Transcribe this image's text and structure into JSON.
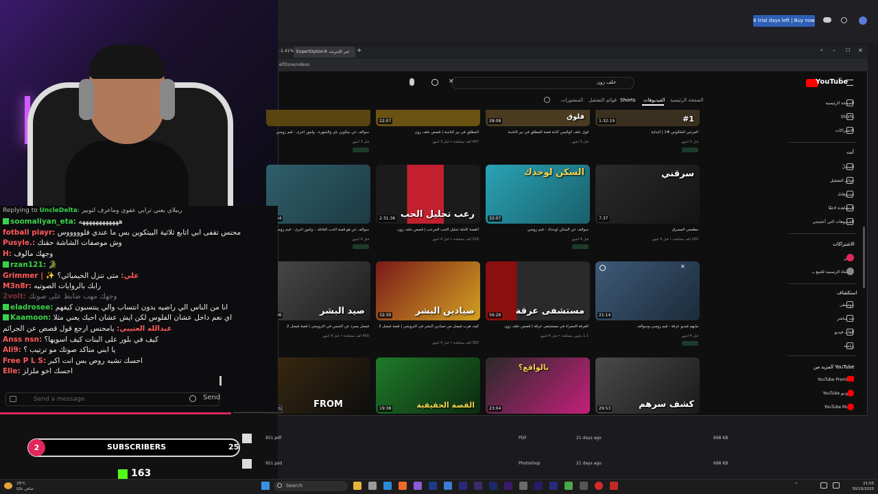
{
  "desktop": {
    "trial_button": "6 trial days left | Buy now"
  },
  "browser": {
    "zoom_pct": "-1.41%",
    "tab_title": "ExpertOption® عبر الإنترنت",
    "url": "elfZone/videos",
    "hover_url": "com/watch?v=8_OV1axd9gg"
  },
  "youtube": {
    "logo": "YouTube",
    "logo_region": "SA",
    "search_query": "خلف زون",
    "nav_tabs": [
      "الصفحة الرئيسية",
      "الفيديوهات",
      "Shorts",
      "قوائم التشغيل",
      "المنشورات"
    ],
    "sidebar": {
      "main": [
        "الصفحة الرئيسية",
        "Shorts",
        "الاشتراكات"
      ],
      "you_header": "أنت",
      "you": [
        "السجلّ",
        "قوائم التشغيل",
        "فيديوهاتك",
        "المشاهدة لاحقًا",
        "الفيديوهات التي أعجبتني"
      ],
      "subs_header": "الاشتراكات",
      "subs": [
        "محس",
        "القناة الرسمية للتنبع بـ..."
      ],
      "explore_header": "استكشاف",
      "explore": [
        "موسيقى",
        "بث مباشر",
        "ألعاب فيديو",
        "رياضة"
      ],
      "more_header": "المزيد من YouTube",
      "more": [
        "YouTube Premium",
        "YouTube استوديو",
        "YouTube Music"
      ]
    },
    "top_row": {
      "durations": [
        "22:07",
        "28:08",
        "1:32:19"
      ],
      "titles": [
        "سوالف عن بيتكوين بأي والشهرة.. وأمور أخرى - قيم زومبي",
        "المطلق في بير الناسة | قصص خلف زون",
        "قول خلف كواليس كتابة قصة المطلق في بير الناسة",
        "المرتبي الملكوس #1 | البداية"
      ],
      "metas": [
        "قبل 3 أشهر",
        "487 ألف مشاهدة • قبل 3 أشهر",
        "قبل 3 أشهر",
        "قبل 3 أشهر"
      ],
      "thumb_texts": [
        "",
        "",
        "فلوق",
        "#1"
      ]
    },
    "row1": [
      {
        "thumb_text": "",
        "duration": "41:54",
        "title": "سوالف عن هو قصة الحب القاتلة .. وأمور أخرى - قيم زومبي",
        "meta": "قبل 4 أشهر"
      },
      {
        "thumb_text": "رعب تحليل الحب",
        "duration": "2:31:36",
        "title": "القصة كاملة تحليل الحب المرعب | قصص خلف زون",
        "meta": "318 ألف مشاهدة • قبل 4 أشهر"
      },
      {
        "thumb_text": "السكن لوحدك",
        "duration": "32:07",
        "title": "سوالف عن السكن لوحدك - قيم زومبي",
        "meta": "قبل 4 أشهر"
      },
      {
        "thumb_text": "سرقني",
        "duration": "7:37",
        "title": "مطعمي المسرق",
        "meta": "240 ألف مشاهدة • قبل 4 أشهر"
      }
    ],
    "row2": [
      {
        "thumb_text": "صيد البشر",
        "duration": "36:36",
        "title": "فيصل يسرد عن الحبس في الترويجي | قصة فيصل 2",
        "meta": "450 ألف مشاهدة • قبل 4 أشهر"
      },
      {
        "thumb_text": "صيادين البشر",
        "duration": "32:30",
        "title": "كيف هرب فيصل من صيادين البشر في الترويجي | قصة فيصل 3",
        "meta": "383 ألف مشاهدة • قبل 4 أشهر"
      },
      {
        "thumb_text": "مستشفى عرقة",
        "duration": "56:26",
        "title": "الغرفة الحمراء في مستشفى عرقة | قصص خلف زون",
        "meta": "1.1 مليون مشاهدة • قبل 4 أشهر"
      },
      {
        "thumb_text": "",
        "duration": "21:14",
        "title": "مايهم فيديو عرقة - قيم زومبي وسوالف",
        "meta": "قبل 4 أشهر"
      }
    ],
    "row3": [
      {
        "thumb_text": "FROM",
        "duration": ""
      },
      {
        "thumb_text": "القصة الحقيقية",
        "duration": "19:38"
      },
      {
        "thumb_text": "بالواقع؟",
        "duration": "23:04"
      },
      {
        "thumb_text": "كشف سرهم",
        "duration": "29:53"
      }
    ],
    "member_badge": "الأعضاء فقط"
  },
  "files": [
    {
      "name": "951.pdf",
      "type": "PDF",
      "date": "21 days ago",
      "size": "698 KB"
    },
    {
      "name": "951.psd",
      "type": "Photoshop",
      "date": "21 days ago",
      "size": "698 KB"
    }
  ],
  "chat": {
    "reply_prefix": "Replying to",
    "reply_user": "UncleDelta",
    "reply_text": ": ربيلاي يعني ترابي عفوي وماعرف لتوبير",
    "messages": [
      {
        "user": "soomaliyan_eta:",
        "text": " ههههههههههههه",
        "badge": true
      },
      {
        "user": "fotball playr:",
        "text": " محنس تقفى ابي اتابع ثلاثية البيتكوين بس ما عندي فلوووووس",
        "badge": false
      },
      {
        "user": "Pusyle.:",
        "text": " وش موصفات الشاشة حقتك",
        "badge": false
      },
      {
        "user": "H:",
        "text": " وجهك مألوف",
        "badge": false
      },
      {
        "user": "rzan121:",
        "text": " 🐊",
        "badge": true
      },
      {
        "user": "Grimmer | ✨ علي:",
        "text": " متى تنزل الخيميائي؟",
        "badge": false
      },
      {
        "user": "M3n8r:",
        "text": " رابك بالروايات الصوتيه",
        "badge": false
      },
      {
        "user": "2volt:",
        "text": " وجهك مهب ضابط على صوتك",
        "badge": false
      },
      {
        "user": "eladrosee:",
        "text": " انا من الناس الي راضيه بدون انتساب والي ينتسبون كيفهم",
        "badge": true
      },
      {
        "user": "Kaamoon:",
        "text": " اي نعم داخل عشان الفلوس لكن ايش عشان احبك يعني مثلا",
        "badge": true
      },
      {
        "user": "عبدالله العتيبي:",
        "text": " يامحنس ارجع قول قصص عن الجرائم",
        "badge": false
      },
      {
        "user": "Anss nsn:",
        "text": " كيف في بلور على البنات كيف اسويها؟",
        "badge": false
      },
      {
        "user": "Ali9:",
        "text": " يا ابني متأكد صوتك مو ترتيب ؟",
        "badge": false
      },
      {
        "user": "Free P L S:",
        "text": " احسك تشبه روص بس انت اكبر",
        "badge": false
      },
      {
        "user": "Elle:",
        "text": " احسك اخو ملزلز",
        "badge": false
      }
    ],
    "input_placeholder": "Send a message",
    "send_label": "Send"
  },
  "subscribers": {
    "current": "2",
    "label": "SUBSCRIBERS",
    "goal": "25",
    "progress": 0.08
  },
  "kick": {
    "followers": "163"
  },
  "taskbar": {
    "search": "Search",
    "weather_temp": "28°C",
    "weather_desc": "صافي غالبًا",
    "time": "21:03",
    "date": "30/10/2025"
  },
  "colors": {
    "accent_pink": "#e0265c",
    "kick_green": "#53fc18",
    "yt_red": "#ff0000"
  }
}
